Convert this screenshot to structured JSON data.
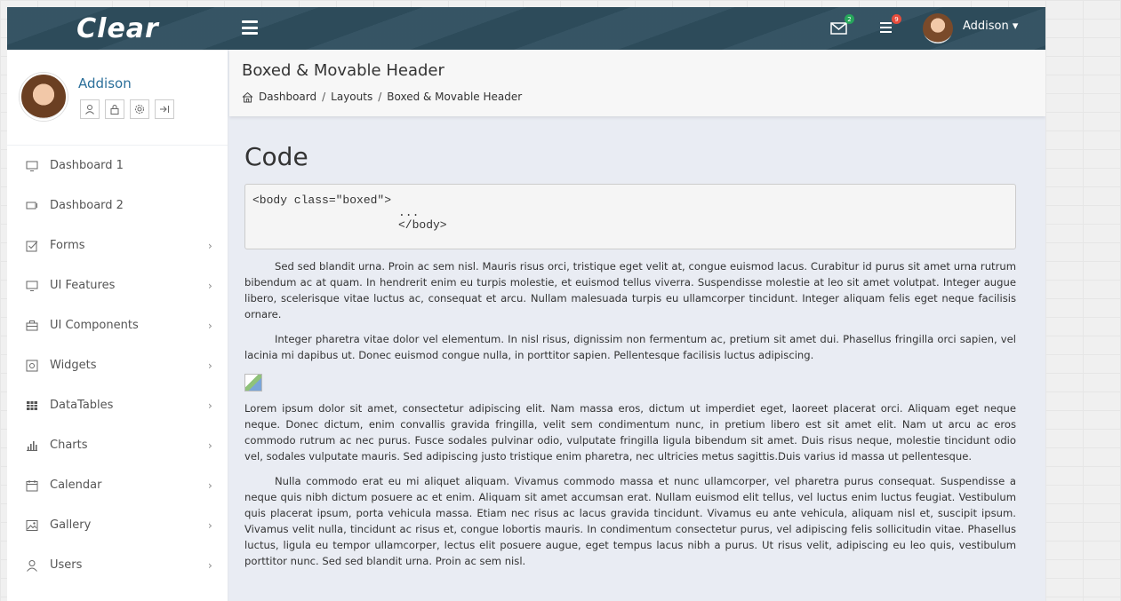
{
  "app": {
    "logo": "Clear"
  },
  "topbar": {
    "mail_badge": "2",
    "list_badge": "9",
    "user_name": "Addison ▾",
    "badge_colors": {
      "mail": "#26a65b",
      "list": "#e74c3c"
    }
  },
  "sidebar": {
    "profile_name": "Addison",
    "items": [
      {
        "label": "Dashboard 1",
        "icon": "monitor-icon",
        "chevron": ""
      },
      {
        "label": "Dashboard 2",
        "icon": "display-icon",
        "chevron": ""
      },
      {
        "label": "Forms",
        "icon": "checkbox-icon",
        "chevron": "›"
      },
      {
        "label": "UI Features",
        "icon": "monitor-icon",
        "chevron": "›"
      },
      {
        "label": "UI Components",
        "icon": "briefcase-icon",
        "chevron": "›"
      },
      {
        "label": "Widgets",
        "icon": "widget-icon",
        "chevron": "›"
      },
      {
        "label": "DataTables",
        "icon": "grid-icon",
        "chevron": "›"
      },
      {
        "label": "Charts",
        "icon": "bar-chart-icon",
        "chevron": "›"
      },
      {
        "label": "Calendar",
        "icon": "calendar-icon",
        "chevron": "›"
      },
      {
        "label": "Gallery",
        "icon": "image-icon",
        "chevron": "›"
      },
      {
        "label": "Users",
        "icon": "user-icon",
        "chevron": "›"
      }
    ]
  },
  "header": {
    "title": "Boxed & Movable Header",
    "breadcrumb": [
      "Dashboard",
      "Layouts",
      "Boxed & Movable Header"
    ],
    "separator": "/"
  },
  "main": {
    "heading": "Code",
    "code_lines": [
      "<body class=\"boxed\">",
      "...",
      "</body>"
    ],
    "paragraphs": [
      "Sed sed blandit urna. Proin ac sem nisl. Mauris risus orci, tristique eget velit at, congue euismod lacus. Curabitur id purus sit amet urna rutrum bibendum ac at quam. In hendrerit enim eu turpis molestie, et euismod tellus viverra. Suspendisse molestie at leo sit amet volutpat. Integer augue libero, scelerisque vitae luctus ac, consequat et arcu. Nullam malesuada turpis eu ullamcorper tincidunt. Integer aliquam felis eget neque facilisis ornare.",
      "Integer pharetra vitae dolor vel elementum. In nisl risus, dignissim non fermentum ac, pretium sit amet dui. Phasellus fringilla orci sapien, vel lacinia mi dapibus ut. Donec euismod congue nulla, in porttitor sapien. Pellentesque facilisis luctus adipiscing.",
      "Lorem ipsum dolor sit amet, consectetur adipiscing elit. Nam massa eros, dictum ut imperdiet eget, laoreet placerat orci. Aliquam eget neque neque. Donec dictum, enim convallis gravida fringilla, velit sem condimentum nunc, in pretium libero est sit amet elit. Nam ut arcu ac eros commodo rutrum ac nec purus. Fusce sodales pulvinar odio, vulputate fringilla ligula bibendum sit amet. Duis risus neque, molestie tincidunt odio vel, sodales vulputate mauris. Sed adipiscing justo tristique enim pharetra, nec ultricies metus sagittis.Duis varius id massa ut pellentesque.",
      "Nulla commodo erat eu mi aliquet aliquam. Vivamus commodo massa et nunc ullamcorper, vel pharetra purus consequat. Suspendisse a neque quis nibh dictum posuere ac et enim. Aliquam sit amet accumsan erat. Nullam euismod elit tellus, vel luctus enim luctus feugiat. Vestibulum quis placerat ipsum, porta vehicula massa. Etiam nec risus ac lacus gravida tincidunt. Vivamus eu ante vehicula, aliquam nisl et, suscipit ipsum. Vivamus velit nulla, tincidunt ac risus et, congue lobortis mauris. In condimentum consectetur purus, vel adipiscing felis sollicitudin vitae. Phasellus luctus, ligula eu tempor ullamcorper, lectus elit posuere augue, eget tempus lacus nibh a purus. Ut risus velit, adipiscing eu leo quis, vestibulum porttitor nunc. Sed sed blandit urna. Proin ac sem nisl."
    ]
  },
  "colors": {
    "topbar": "#2f4f5f",
    "accent": "#2b6f9a"
  }
}
